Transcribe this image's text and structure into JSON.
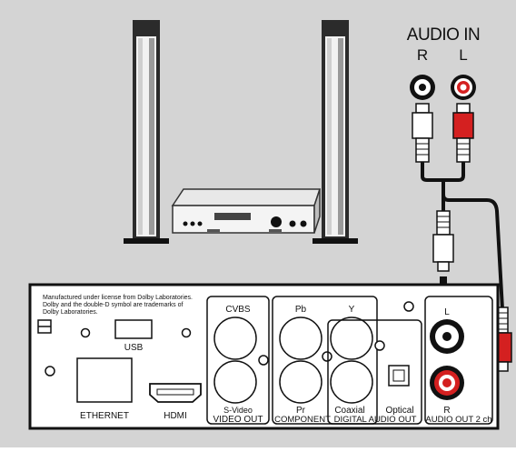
{
  "receiver": {
    "audio_in_title": "AUDIO IN",
    "channel_r": "R",
    "channel_l": "L"
  },
  "panel": {
    "license_line1": "Manufactured under license from Dolby Laboratories.",
    "license_line2": "Dolby and the double-D symbol are trademarks of",
    "license_line3": "Dolby Laboratories.",
    "usb": "USB",
    "ethernet": "ETHERNET",
    "hdmi": "HDMI",
    "cvbs": "CVBS",
    "svideo": "S-Video",
    "video_out": "VIDEO OUT",
    "pb": "Pb",
    "y": "Y",
    "pr": "Pr",
    "component": "COMPONENT",
    "coaxial": "Coaxial",
    "optical": "Optical",
    "digital_audio_out": "DIGITAL AUDIO OUT",
    "jack_l": "L",
    "jack_r": "R",
    "audio_out_2ch": "AUDIO OUT 2 ch"
  },
  "colors": {
    "background": "#d4d4d4",
    "panel": "#ffffff",
    "cable": "#111111",
    "red_plug": "#d42020",
    "speaker": "#333333"
  }
}
